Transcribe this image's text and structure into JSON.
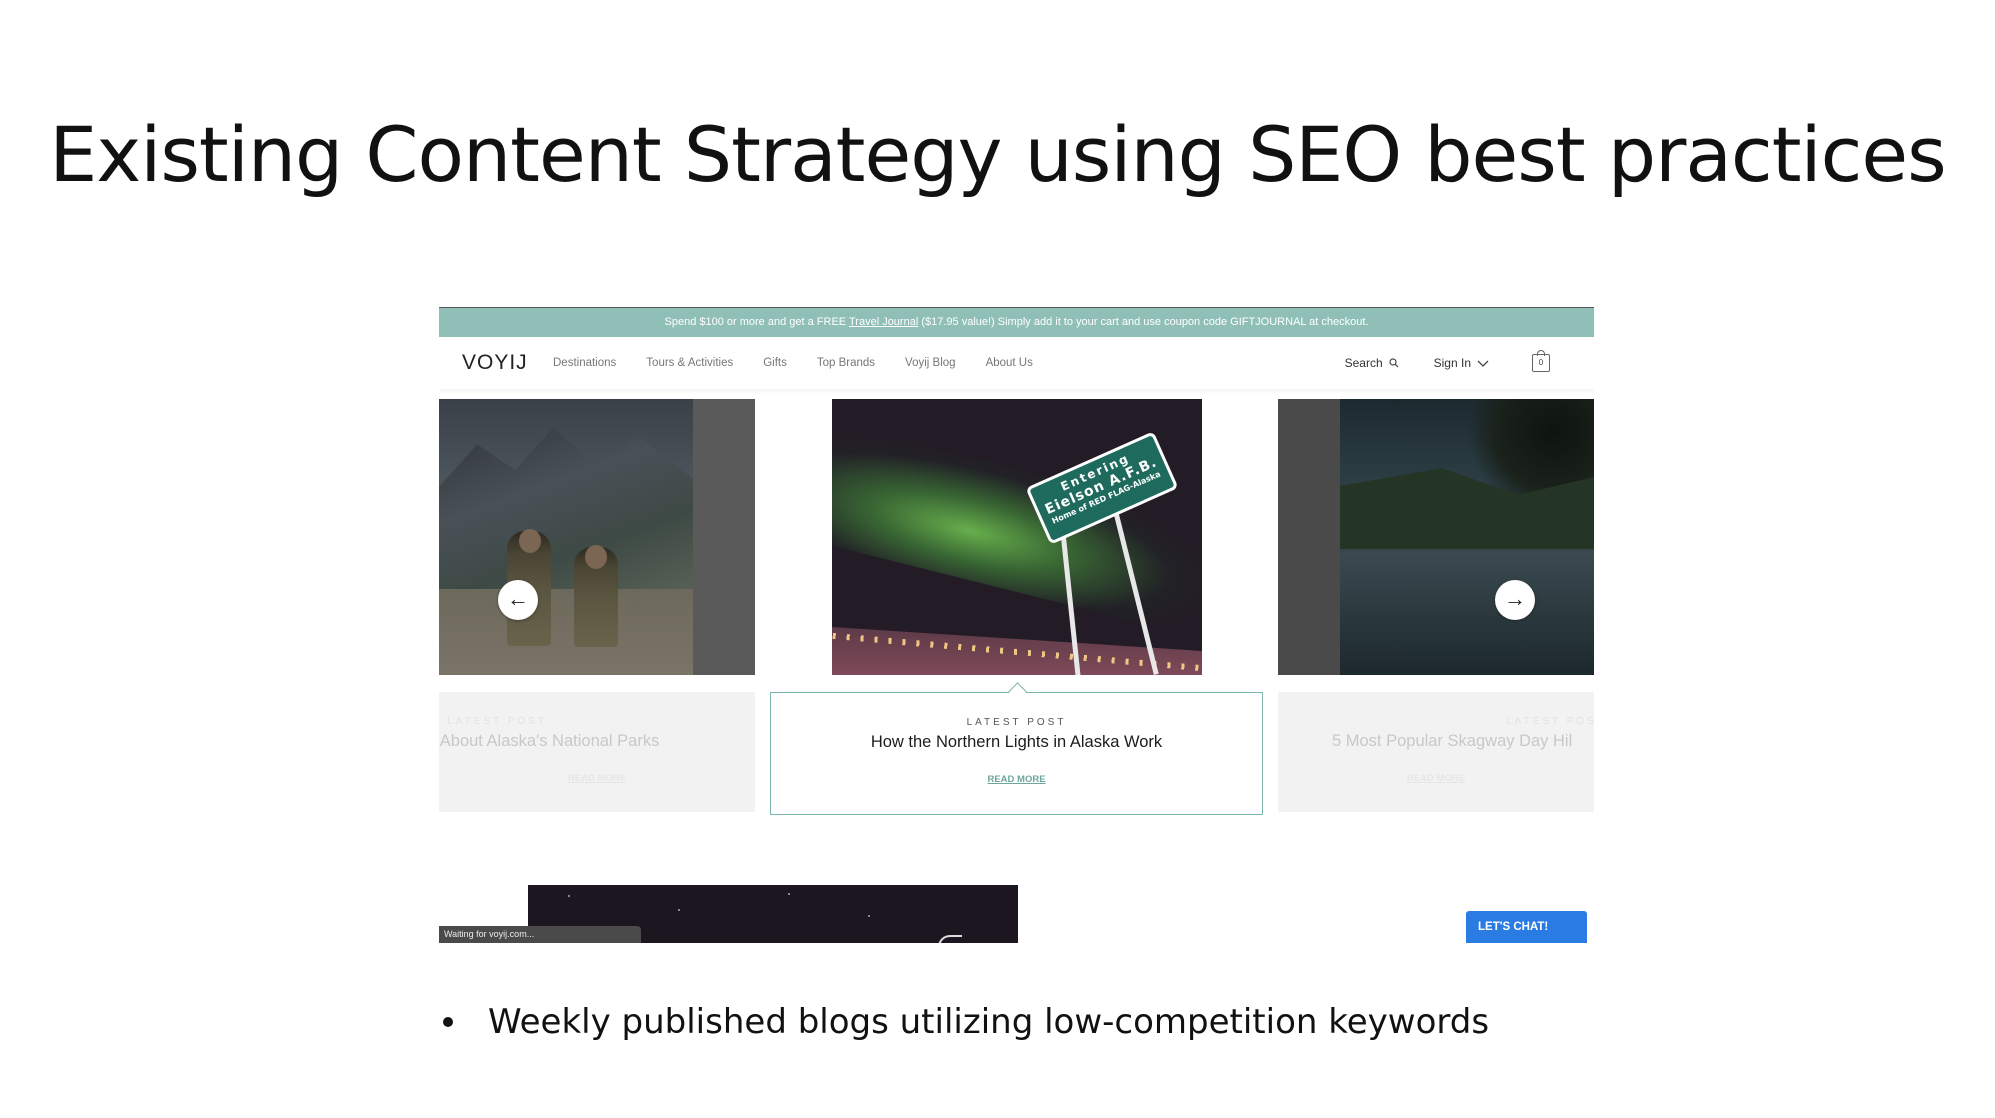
{
  "slide": {
    "title": "Existing Content Strategy using SEO best practices",
    "bullets": [
      "Weekly published blogs utilizing low-competition keywords"
    ]
  },
  "site": {
    "promo": {
      "before_link": "Spend $100 or more and get a FREE ",
      "link": "Travel Journal",
      "after_link": " ($17.95 value!) Simply add it to your cart and use coupon code GIFTJOURNAL at checkout."
    },
    "logo": "VOYIJ",
    "nav": [
      "Destinations",
      "Tours & Activities",
      "Gifts",
      "Top Brands",
      "Voyij Blog",
      "About Us"
    ],
    "search_label": "Search",
    "search_icon": "search-icon",
    "signin_label": "Sign In",
    "cart_count": "0",
    "carousel": {
      "sign": {
        "line1": "Entering",
        "line2": "Eielson A.F.B.",
        "line3": "Home of RED FLAG-Alaska"
      },
      "prev_glyph": "←",
      "next_glyph": "→",
      "left": {
        "kicker": "LATEST POST",
        "title": "cts About Alaska's National Parks",
        "read_more": "READ MORE"
      },
      "center": {
        "kicker": "LATEST POST",
        "title": "How the Northern Lights in Alaska Work",
        "read_more": "READ MORE"
      },
      "right": {
        "kicker": "LATEST POST",
        "title": "5 Most Popular Skagway Day Hil",
        "read_more": "READ MORE"
      }
    },
    "status_text": "Waiting for voyij.com...",
    "chat_label": "LET'S CHAT!"
  },
  "colors": {
    "promo_bg": "#8fbfb7",
    "accent": "#7bb7ac",
    "chat_blue": "#2b7be4"
  }
}
